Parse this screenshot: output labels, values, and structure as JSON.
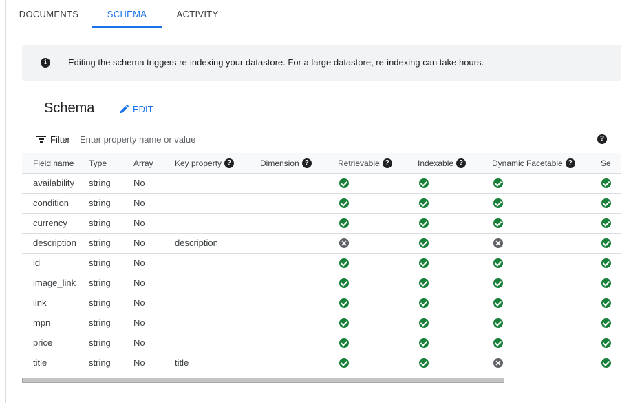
{
  "tabs": [
    {
      "label": "DOCUMENTS",
      "active": false
    },
    {
      "label": "SCHEMA",
      "active": true
    },
    {
      "label": "ACTIVITY",
      "active": false
    }
  ],
  "banner": {
    "icon": "info-icon",
    "message": "Editing the schema triggers re-indexing your datastore. For a large datastore, re-indexing can take hours."
  },
  "schema": {
    "title": "Schema",
    "edit_label": "EDIT"
  },
  "filter": {
    "label": "Filter",
    "placeholder": "Enter property name or value"
  },
  "table": {
    "columns": [
      "Field name",
      "Type",
      "Array",
      "Key property",
      "Dimension",
      "Retrievable",
      "Indexable",
      "Dynamic Facetable",
      "Se"
    ],
    "rows": [
      {
        "field": "availability",
        "type": "string",
        "array": "No",
        "key": "",
        "dimension": "",
        "retrievable": true,
        "indexable": true,
        "facetable": true,
        "se": true
      },
      {
        "field": "condition",
        "type": "string",
        "array": "No",
        "key": "",
        "dimension": "",
        "retrievable": true,
        "indexable": true,
        "facetable": true,
        "se": true
      },
      {
        "field": "currency",
        "type": "string",
        "array": "No",
        "key": "",
        "dimension": "",
        "retrievable": true,
        "indexable": true,
        "facetable": true,
        "se": true
      },
      {
        "field": "description",
        "type": "string",
        "array": "No",
        "key": "description",
        "dimension": "",
        "retrievable": false,
        "indexable": true,
        "facetable": false,
        "se": true
      },
      {
        "field": "id",
        "type": "string",
        "array": "No",
        "key": "",
        "dimension": "",
        "retrievable": true,
        "indexable": true,
        "facetable": true,
        "se": true
      },
      {
        "field": "image_link",
        "type": "string",
        "array": "No",
        "key": "",
        "dimension": "",
        "retrievable": true,
        "indexable": true,
        "facetable": true,
        "se": true
      },
      {
        "field": "link",
        "type": "string",
        "array": "No",
        "key": "",
        "dimension": "",
        "retrievable": true,
        "indexable": true,
        "facetable": true,
        "se": true
      },
      {
        "field": "mpn",
        "type": "string",
        "array": "No",
        "key": "",
        "dimension": "",
        "retrievable": true,
        "indexable": true,
        "facetable": true,
        "se": true
      },
      {
        "field": "price",
        "type": "string",
        "array": "No",
        "key": "",
        "dimension": "",
        "retrievable": true,
        "indexable": true,
        "facetable": true,
        "se": true
      },
      {
        "field": "title",
        "type": "string",
        "array": "No",
        "key": "title",
        "dimension": "",
        "retrievable": true,
        "indexable": true,
        "facetable": false,
        "se": true
      }
    ]
  },
  "colors": {
    "accent": "#1a73e8",
    "enabled": "#188038",
    "disabled": "#5f6368",
    "banner_bg": "#f1f3f4"
  }
}
